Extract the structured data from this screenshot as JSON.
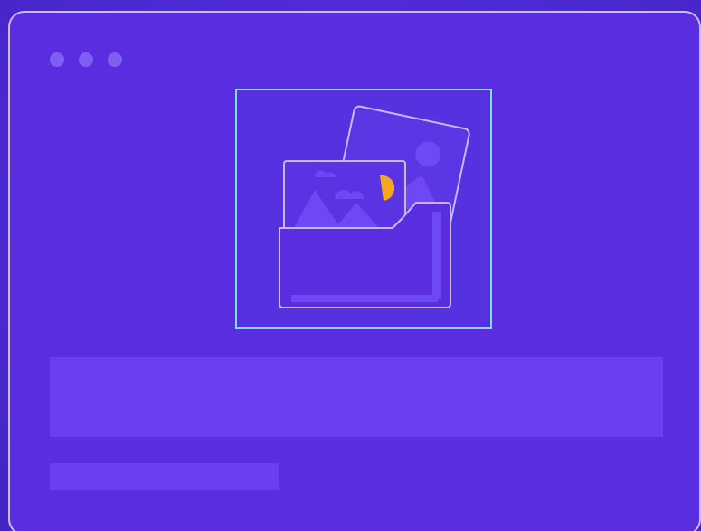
{
  "window": {
    "controls": [
      {
        "name": "window-dot-1"
      },
      {
        "name": "window-dot-2"
      },
      {
        "name": "window-dot-3"
      }
    ]
  },
  "illustration": {
    "icons": [
      "folder-icon",
      "photo-icon",
      "sun-icon",
      "mountain-icon",
      "cloud-icon"
    ],
    "colors": {
      "frame_border": "#7fe0d6",
      "line_art": "#c9b8ff",
      "sun": "#f5a623",
      "fill_light": "#6e48f2"
    }
  },
  "placeholders": {
    "title_bar": "",
    "subtitle_bar": ""
  }
}
